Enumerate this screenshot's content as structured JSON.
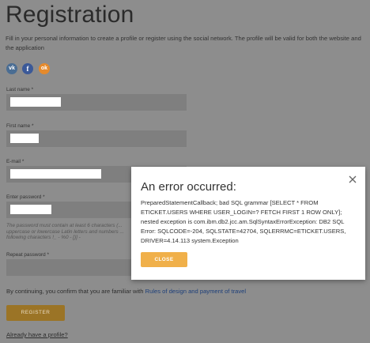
{
  "page": {
    "title": "Registration",
    "intro": "Fill in your personal information to create a profile or register using the social network. The profile will be valid for both the website and the application",
    "social": [
      {
        "name": "vk-icon",
        "glyph": "vk",
        "color": "#4a6d93"
      },
      {
        "name": "facebook-icon",
        "glyph": "f",
        "color": "#3b5998"
      },
      {
        "name": "odnoklassniki-icon",
        "glyph": "ok",
        "color": "#e58a2c"
      }
    ]
  },
  "form": {
    "last_name_label": "Last name *",
    "first_name_label": "First name *",
    "email_label": "E-mail *",
    "password_label": "Enter password *",
    "password_hint": "The password must contain at least 6 characters (... uppercase or lowercase Latin letters and numbers ... following characters !_ - %0 - [)] -",
    "repeat_password_label": "Repeat password *",
    "consent_text": "By continuing, you confirm that you are familiar with",
    "consent_link": "Rules of design and payment of travel",
    "register_label": "REGISTER",
    "have_profile_link": "Already have a profile?"
  },
  "dialog": {
    "title": "An error occurred:",
    "message": "PreparedStatementCallback; bad SQL grammar [SELECT * FROM ETICKET.USERS WHERE USER_LOGIN=? FETCH FIRST 1 ROW ONLY]; nested exception is com.ibm.db2.jcc.am.SqlSyntaxErrorException: DB2 SQL Error: SQLCODE=-204, SQLSTATE=42704, SQLERRMC=ETICKET.USERS, DRIVER=4.14.113 system.Exception",
    "close_label": "CLOSE",
    "accent": "#f0b04a"
  }
}
